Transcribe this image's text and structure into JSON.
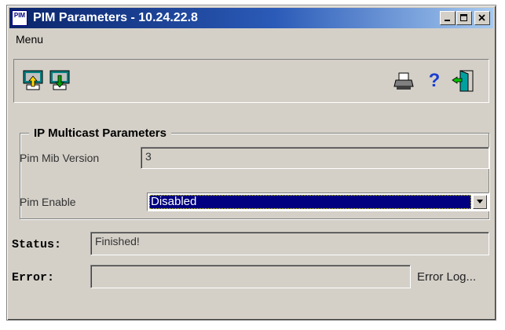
{
  "window": {
    "title": "PIM Parameters - 10.24.22.8",
    "app_icon_text": "PIM"
  },
  "menu": {
    "label": "Menu"
  },
  "toolbar": {
    "icons": [
      "upload-icon",
      "download-icon",
      "printer-icon",
      "help-icon",
      "exit-icon"
    ],
    "help_glyph": "?"
  },
  "group": {
    "title": "IP Multicast Parameters",
    "mib_label": "Pim Mib Version",
    "mib_value": "3",
    "enable_label": "Pim Enable",
    "enable_value": "Disabled"
  },
  "status": {
    "label": "Status:",
    "value": "Finished!"
  },
  "error": {
    "label": "Error:",
    "value": "",
    "log_link": "Error Log..."
  },
  "colors": {
    "titlebar_start": "#0a246a",
    "titlebar_end": "#a6caf0",
    "face": "#d4d0c8",
    "selection": "#000080"
  }
}
